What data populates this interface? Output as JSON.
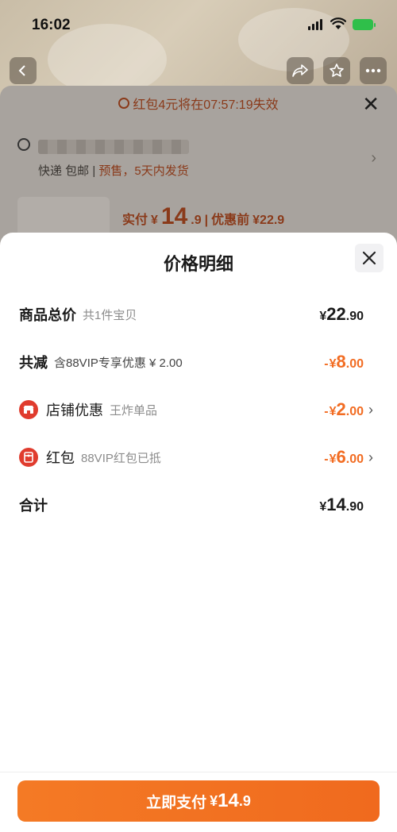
{
  "status_bar": {
    "time": "16:02"
  },
  "background": {
    "notice": "红包4元将在07:57:19失效",
    "shipping_method": "快递 包邮",
    "shipping_note": "预售，5天内发货",
    "price_label": "实付",
    "price_currency": "¥",
    "price_int": "14",
    "price_dec": ".9",
    "original_label": "优惠前",
    "original_price": "¥22.9"
  },
  "sheet": {
    "title": "价格明细",
    "rows": [
      {
        "label": "商品总价",
        "sub": "共1件宝贝",
        "sign": "",
        "currency": "¥",
        "int": "22",
        "dec": ".90"
      },
      {
        "label": "共减",
        "sub": "含88VIP专享优惠 ¥ 2.00",
        "sign": "-",
        "currency": "¥",
        "int": "8",
        "dec": ".00"
      },
      {
        "label": "店铺优惠",
        "sub": "王炸单品",
        "sign": "-",
        "currency": "¥",
        "int": "2",
        "dec": ".00",
        "icon": "shop-icon"
      },
      {
        "label": "红包",
        "sub": "88VIP红包已抵",
        "sign": "-",
        "currency": "¥",
        "int": "6",
        "dec": ".00",
        "icon": "red-envelope-icon"
      },
      {
        "label": "合计",
        "sub": "",
        "sign": "",
        "currency": "¥",
        "int": "14",
        "dec": ".90"
      }
    ]
  },
  "pay_button": {
    "label": "立即支付",
    "currency": "¥",
    "int": "14",
    "dec": ".9"
  },
  "colors": {
    "accent": "#f26c22",
    "icon_red": "#e03c2e"
  }
}
